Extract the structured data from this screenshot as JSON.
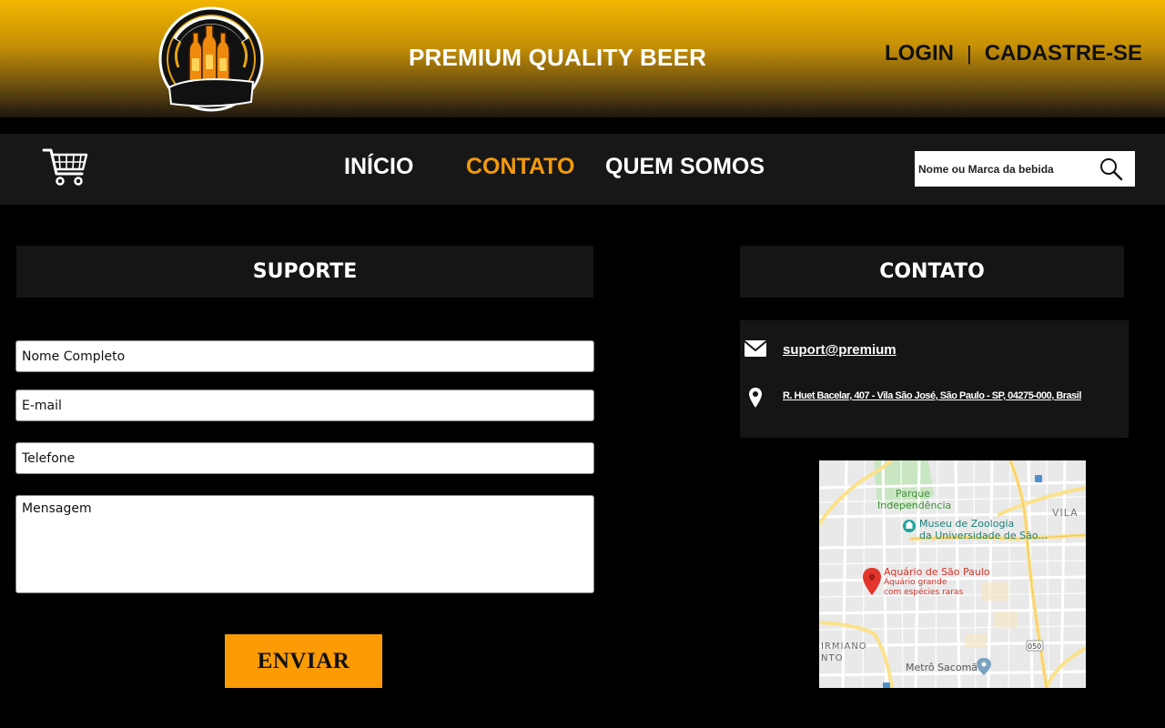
{
  "header": {
    "logo_name": "Premium Quality Beer logo",
    "title": "PREMIUM QUALITY BEER",
    "login_label": "LOGIN",
    "separator": "|",
    "signup_label": "CADASTRE-SE"
  },
  "nav": {
    "cart_icon": "shopping-cart-icon",
    "items": [
      {
        "label": "INÍCIO",
        "active": false
      },
      {
        "label": "CONTATO",
        "active": true
      },
      {
        "label": "QUEM SOMOS",
        "active": false
      }
    ],
    "active_color": "#f39a0c",
    "search": {
      "placeholder": "Nome ou Marca da bebida",
      "icon": "search-icon"
    }
  },
  "support": {
    "title": "SUPORTE",
    "fields": {
      "name_placeholder": "Nome Completo",
      "email_placeholder": "E-mail",
      "phone_placeholder": "Telefone",
      "message_placeholder": "Mensagem"
    },
    "submit_label": "ENVIAR",
    "submit_color": "#fb9b05"
  },
  "contact": {
    "title": "CONTATO",
    "email": "suport@premium",
    "email_icon": "envelope-icon",
    "address": "R. Huet Bacelar, 407 - Vila São José, São Paulo - SP, 04275-000, Brasil",
    "address_icon": "map-pin-icon"
  },
  "map": {
    "park": "Parque",
    "park2": "Independência",
    "museum": "Museu de Zoologia",
    "museum2": "da Universidade de São...",
    "place": "Aquário de São Paulo",
    "place_sub1": "Aquário grande",
    "place_sub2": "com espécies raras",
    "district": "VILA",
    "district2": "IRMIANO",
    "district3": "NTO",
    "metro": "Metrô Sacomã",
    "road_badge": "050"
  }
}
